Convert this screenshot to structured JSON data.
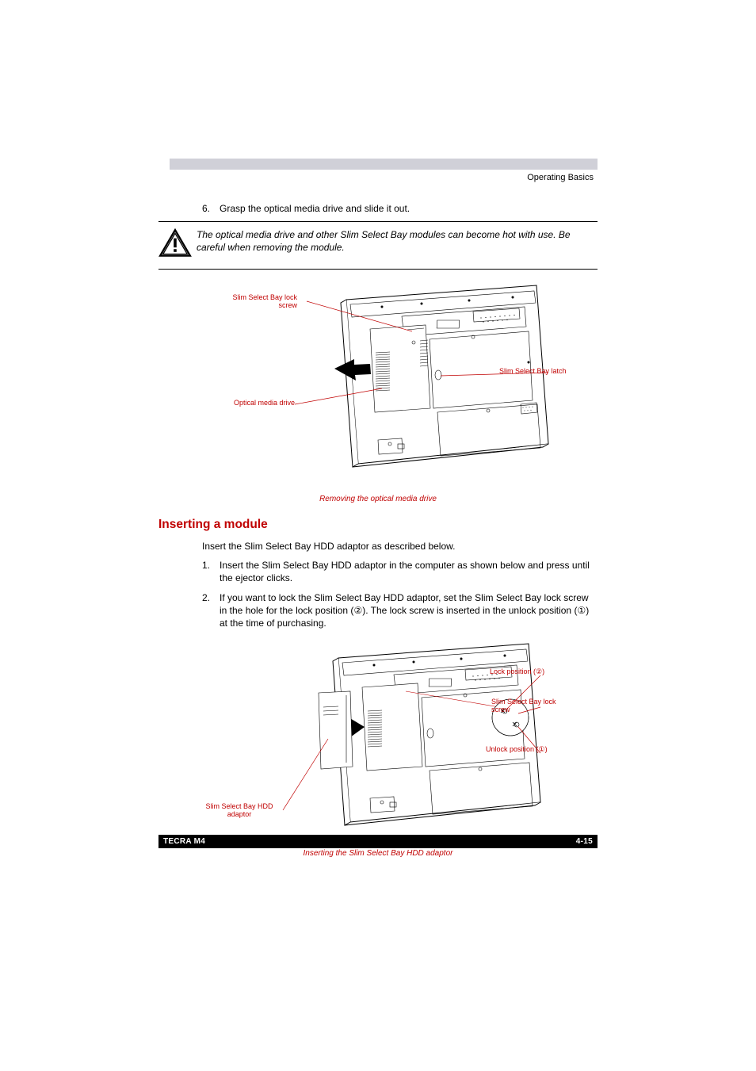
{
  "header": {
    "section": "Operating Basics"
  },
  "step6": {
    "num": "6.",
    "text": "Grasp the optical media drive and slide it out."
  },
  "caution": {
    "text": "The optical media drive and other Slim Select Bay modules can become hot with use. Be careful when removing the module."
  },
  "figure1": {
    "labels": {
      "lock_screw": "Slim Select Bay lock screw",
      "latch": "Slim Select Bay latch",
      "drive": "Optical media drive"
    },
    "caption": "Removing the optical media drive"
  },
  "section": {
    "heading": "Inserting a module",
    "intro": "Insert the Slim Select Bay HDD adaptor as described below."
  },
  "steps": {
    "s1": {
      "num": "1.",
      "text": "Insert the Slim Select Bay HDD adaptor in the computer as shown below and press until the ejector clicks."
    },
    "s2": {
      "num": "2.",
      "text_a": "If you want to lock the Slim Select Bay HDD adaptor, set the Slim Select Bay lock screw in the hole for the lock position (",
      "sym2": "②",
      "text_b": "). The lock screw is inserted in the unlock position (",
      "sym1": "①",
      "text_c": ") at the time of purchasing."
    }
  },
  "figure2": {
    "labels": {
      "lock_pos_a": "Lock position (",
      "lock_pos_sym": "②",
      "lock_pos_b": ")",
      "lock_screw": "Slim Select Bay lock screw",
      "unlock_pos_a": "Unlock position (",
      "unlock_pos_sym": "①",
      "unlock_pos_b": ")",
      "adaptor": "Slim Select Bay HDD adaptor"
    },
    "caption": "Inserting the Slim Select Bay HDD adaptor"
  },
  "footer": {
    "model": "TECRA M4",
    "page": "4-15"
  }
}
